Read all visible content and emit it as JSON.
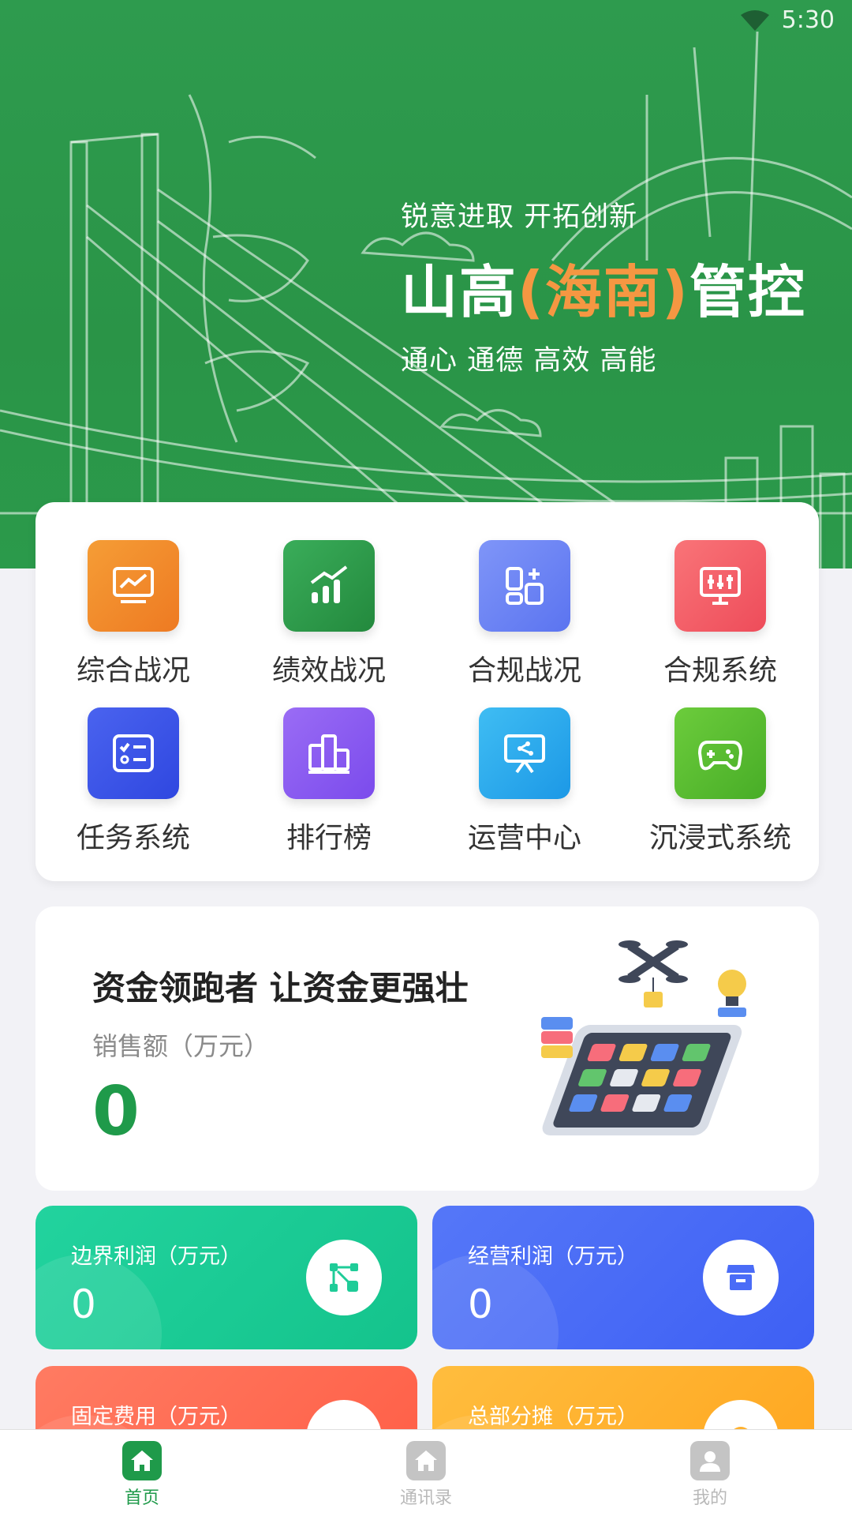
{
  "status_bar": {
    "time": "5:30",
    "wifi_icon": "wifi-icon"
  },
  "hero": {
    "slogan_top": "锐意进取 开拓创新",
    "title_part1": "山高",
    "title_highlight": "(海南)",
    "title_part2": "管控",
    "slogan_bottom": "通心 通德 高效 高能",
    "highlight_color": "#f59742",
    "background_color": "#2e9b4e"
  },
  "menu": {
    "items": [
      {
        "label": "综合战况",
        "icon": "monitor-chart-icon",
        "color": "#f08a2c"
      },
      {
        "label": "绩效战况",
        "icon": "growth-bar-chart-icon",
        "color": "#2f9e4c"
      },
      {
        "label": "合规战况",
        "icon": "dashboard-tiles-icon",
        "color": "#6f86f5"
      },
      {
        "label": "合规系统",
        "icon": "control-panel-icon",
        "color": "#f4616a"
      },
      {
        "label": "任务系统",
        "icon": "task-list-icon",
        "color": "#3d58ea"
      },
      {
        "label": "排行榜",
        "icon": "podium-icon",
        "color": "#8c5cf0"
      },
      {
        "label": "运营中心",
        "icon": "presentation-board-icon",
        "color": "#29a9ec"
      },
      {
        "label": "沉浸式系统",
        "icon": "gamepad-icon",
        "color": "#5cc032"
      }
    ]
  },
  "promo": {
    "title": "资金领跑者 让资金更强壮",
    "sales_label": "销售额（万元）",
    "sales_value": "0",
    "illustration": "phone-drone-illustration"
  },
  "stats": [
    {
      "label": "边界利润（万元）",
      "value": "0",
      "icon": "network-nodes-icon",
      "color": "#1fcc98"
    },
    {
      "label": "经营利润（万元）",
      "value": "0",
      "icon": "store-icon",
      "color": "#4a6cf7"
    },
    {
      "label": "固定费用（万元）",
      "value": "",
      "icon": "cost-icon",
      "color": "#ff6b53"
    },
    {
      "label": "总部分摊（万元）",
      "value": "",
      "icon": "coin-icon",
      "color": "#ffb12e"
    }
  ],
  "tabbar": {
    "items": [
      {
        "label": "首页",
        "icon": "home-icon",
        "active": true
      },
      {
        "label": "通讯录",
        "icon": "contacts-home-icon",
        "active": false
      },
      {
        "label": "我的",
        "icon": "user-icon",
        "active": false
      }
    ],
    "active_color": "#1f9a4a",
    "inactive_color": "#b9b9b9"
  }
}
